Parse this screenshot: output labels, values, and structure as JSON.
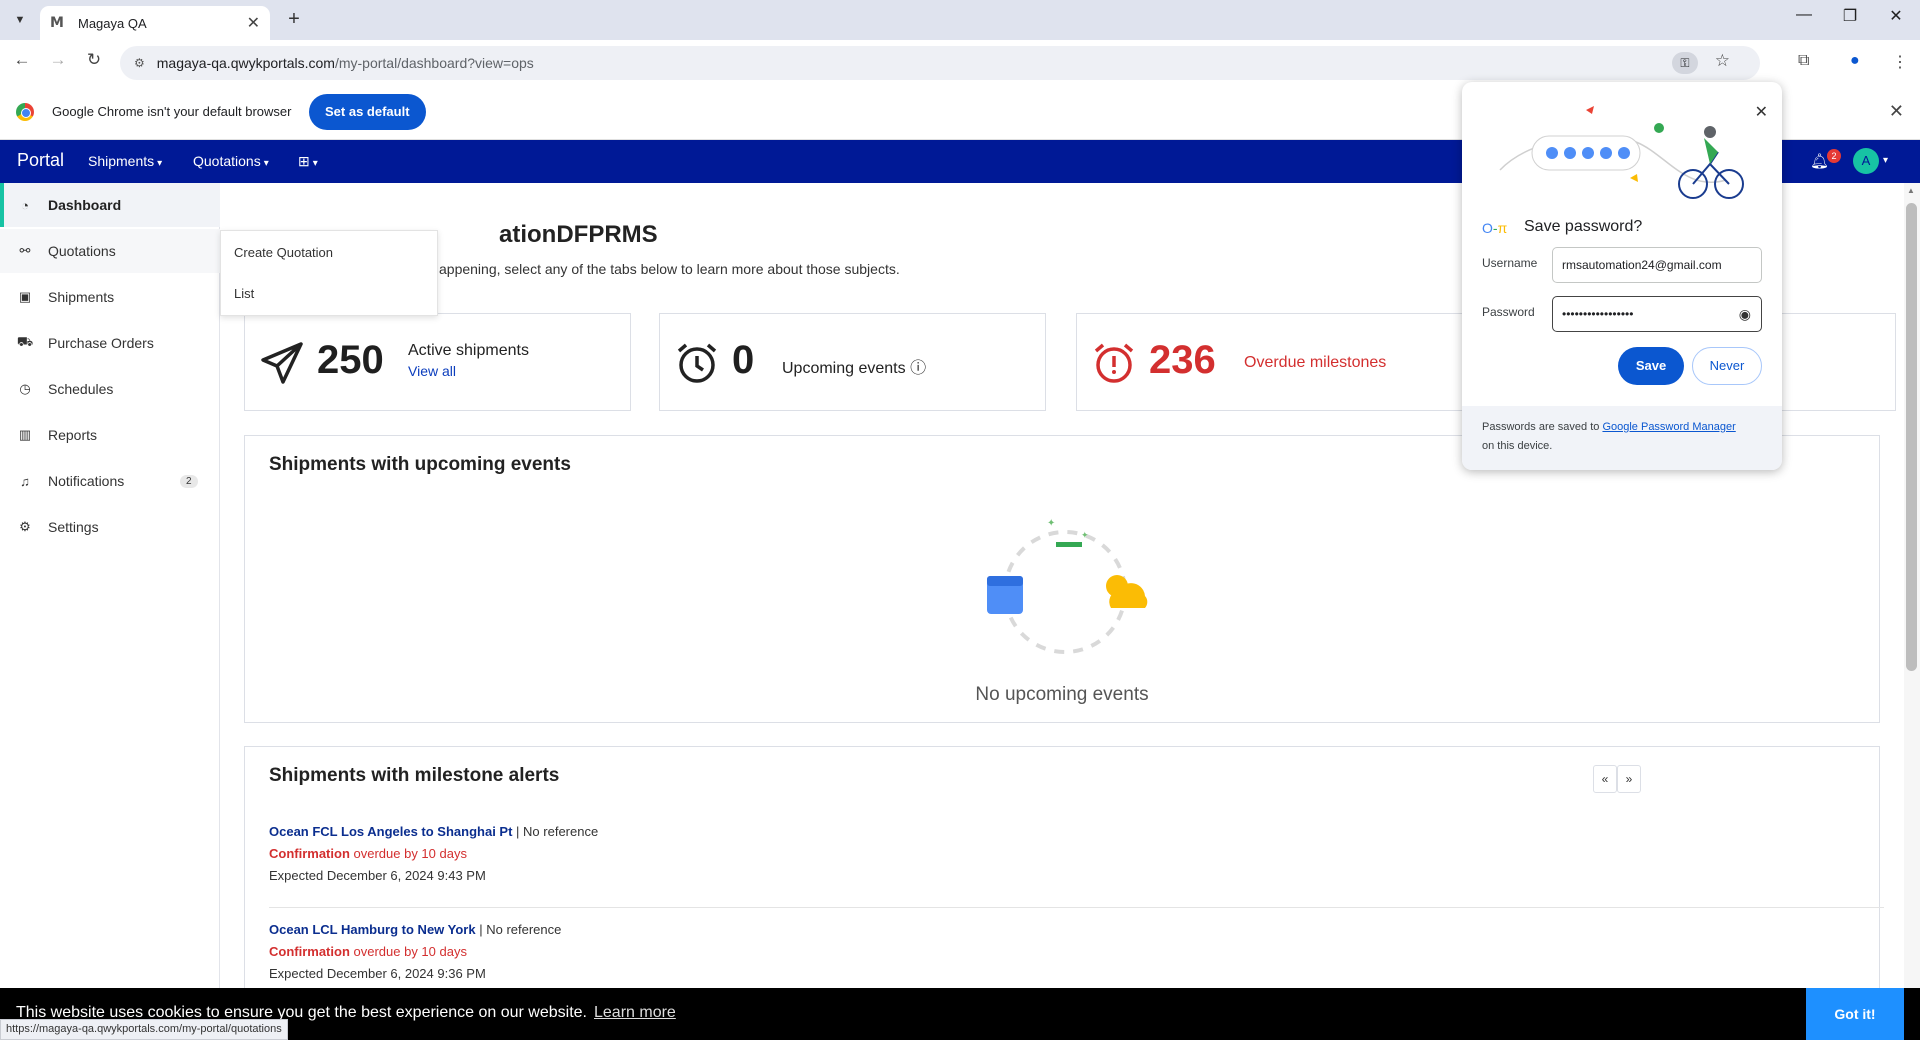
{
  "browser": {
    "tab_title": "Magaya QA",
    "tab_favicon": "M",
    "url_host": "magaya-qa.qwykportals.com",
    "url_path": "/my-portal/dashboard?view=ops",
    "infobar_text": "Google Chrome isn't your default browser",
    "set_default_label": "Set as default",
    "status_url": "https://magaya-qa.qwykportals.com/my-portal/quotations"
  },
  "header": {
    "brand": "Portal",
    "menu_shipments": "Shipments",
    "menu_quotations": "Quotations",
    "notification_count": "2",
    "avatar_initial": "A"
  },
  "sidebar": {
    "items": [
      {
        "label": "Dashboard",
        "icon": "dashboard-icon"
      },
      {
        "label": "Quotations",
        "icon": "quotations-icon"
      },
      {
        "label": "Shipments",
        "icon": "shipments-icon"
      },
      {
        "label": "Purchase Orders",
        "icon": "cart-icon"
      },
      {
        "label": "Schedules",
        "icon": "clock-icon"
      },
      {
        "label": "Reports",
        "icon": "chart-icon"
      },
      {
        "label": "Notifications",
        "icon": "bell-icon",
        "badge": "2"
      },
      {
        "label": "Settings",
        "icon": "gear-icon"
      }
    ]
  },
  "dropdown": {
    "items": [
      "Create Quotation",
      "List"
    ]
  },
  "main": {
    "title": "ationDFPRMS",
    "subtitle": "appening, select any of the tabs below to learn more about those subjects.",
    "stats": [
      {
        "value": "250",
        "label": "Active shipments",
        "link": "View all"
      },
      {
        "value": "0",
        "label": "Upcoming events"
      },
      {
        "value": "236",
        "label": "Overdue milestones"
      }
    ],
    "upcoming_title": "Shipments with upcoming events",
    "upcoming_empty": "No upcoming events",
    "alerts_title": "Shipments with milestone alerts",
    "pager_prev": "«",
    "pager_next": "»",
    "alerts": [
      {
        "route": "Ocean FCL Los Angeles to Shanghai Pt",
        "reference": " | No reference",
        "milestone": "Confirmation",
        "overdue": " overdue by 10 days",
        "expected": "Expected December 6, 2024 9:43 PM"
      },
      {
        "route": "Ocean LCL Hamburg to New York",
        "reference": " | No reference",
        "milestone": "Confirmation",
        "overdue": " overdue by 10 days",
        "expected": "Expected December 6, 2024 9:36 PM"
      }
    ]
  },
  "password_popup": {
    "title": "Save password?",
    "username_label": "Username",
    "username_value": "rmsautomation24@gmail.com",
    "password_label": "Password",
    "password_value": "•••••••••••••••••",
    "save_label": "Save",
    "never_label": "Never",
    "footer_prefix": "Passwords are saved to ",
    "footer_link": "Google Password Manager",
    "footer_suffix": "on this device."
  },
  "cookie": {
    "text": "This website uses cookies to ensure you get the best experience on our website.",
    "link": "Learn more",
    "button": "Got it!"
  },
  "colors": {
    "header_bg": "#001996",
    "accent": "#17c3a4",
    "danger": "#d32f2f",
    "chrome_blue": "#0b57d0"
  }
}
